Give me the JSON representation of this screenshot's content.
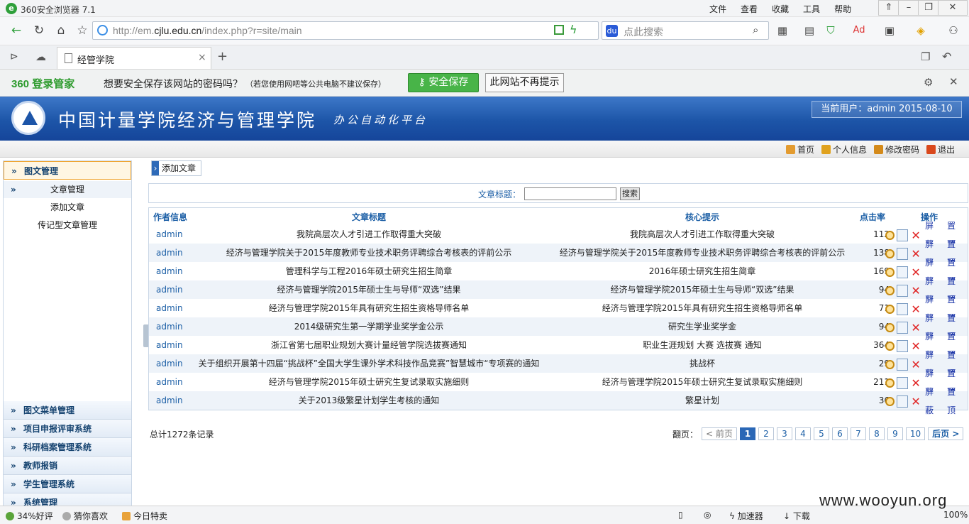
{
  "browser": {
    "title": "360安全浏览器 7.1",
    "menus": [
      "文件",
      "查看",
      "收藏",
      "工具",
      "帮助"
    ],
    "url_prefix": "http://em.",
    "url_domain": "cjlu.edu.cn",
    "url_suffix": "/index.php?r=site/main",
    "search_placeholder": "点此搜索",
    "tab_title": "经管学院",
    "status_items": [
      "34%好评",
      "猜你喜欢",
      "今日特卖"
    ],
    "status_right": [
      "加速器",
      "下载",
      "100%"
    ],
    "watermark": "www.wooyun.org"
  },
  "password_bar": {
    "brand": "360 登录管家",
    "question": "想要安全保存该网站的密码吗？",
    "note": "（若您使用网吧等公共电脑不建议保存）",
    "save_label": "安全保存",
    "never_label": "此网站不再提示"
  },
  "site": {
    "name": "中国计量学院经济与管理学院",
    "subtitle": "办公自动化平台",
    "current_user": "当前用户：admin 2015-08-10",
    "top_links": [
      "首页",
      "个人信息",
      "修改密码",
      "退出"
    ]
  },
  "sidebar": {
    "active_group": "图文管理",
    "sub_items": [
      "文章管理",
      "添加文章",
      "传记型文章管理"
    ],
    "groups": [
      "图文菜单管理",
      "项目申报评审系统",
      "科研档案管理系统",
      "教师报销",
      "学生管理系统",
      "系统管理"
    ]
  },
  "main": {
    "crumb": "添加文章",
    "filter_label": "文章标题：",
    "search_button": "搜索",
    "columns": {
      "author": "作者信息",
      "title": "文章标题",
      "hint": "核心提示",
      "clicks": "点击率",
      "ops": "操作"
    },
    "op_labels": {
      "hide": "屏蔽",
      "top": "置顶"
    },
    "rows": [
      {
        "author": "admin",
        "title": "我院高层次人才引进工作取得重大突破",
        "hint": "我院高层次人才引进工作取得重大突破",
        "clicks": "112"
      },
      {
        "author": "admin",
        "title": "经济与管理学院关于2015年度教师专业技术职务评聘综合考核表的评前公示",
        "hint": "经济与管理学院关于2015年度教师专业技术职务评聘综合考核表的评前公示",
        "clicks": "138"
      },
      {
        "author": "admin",
        "title": "管理科学与工程2016年硕士研究生招生简章",
        "hint": "2016年硕士研究生招生简章",
        "clicks": "169"
      },
      {
        "author": "admin",
        "title": "经济与管理学院2015年硕士生与导师“双选”结果",
        "hint": "经济与管理学院2015年硕士生与导师“双选”结果",
        "clicks": "94"
      },
      {
        "author": "admin",
        "title": "经济与管理学院2015年具有研究生招生资格导师名单",
        "hint": "经济与管理学院2015年具有研究生招生资格导师名单",
        "clicks": "71"
      },
      {
        "author": "admin",
        "title": "2014级研究生第一学期学业奖学金公示",
        "hint": "研究生学业奖学金",
        "clicks": "94"
      },
      {
        "author": "admin",
        "title": "浙江省第七届职业规划大赛计量经管学院选拔赛通知",
        "hint": "职业生涯规划 大赛 选拔赛 通知",
        "clicks": "364"
      },
      {
        "author": "admin",
        "title": "关于组织开展第十四届“挑战杯”全国大学生课外学术科技作品竞赛”智慧城市“专项赛的通知",
        "hint": "挑战杯",
        "clicks": "29"
      },
      {
        "author": "admin",
        "title": "经济与管理学院2015年硕士研究生复试录取实施细则",
        "hint": "经济与管理学院2015年硕士研究生复试录取实施细则",
        "clicks": "211"
      },
      {
        "author": "admin",
        "title": "关于2013级繁星计划学生考核的通知",
        "hint": "繁星计划",
        "clicks": "36"
      }
    ],
    "total": "总计1272条记录",
    "pager": {
      "label": "翻页：",
      "prev": "< 前页",
      "pages": [
        "1",
        "2",
        "3",
        "4",
        "5",
        "6",
        "7",
        "8",
        "9",
        "10"
      ],
      "current": "1",
      "next": "后页 >"
    }
  },
  "colors": {
    "banner": "#1d55a8",
    "link": "#1c5fa6",
    "save_button": "#48b448",
    "delete": "#e02424"
  }
}
